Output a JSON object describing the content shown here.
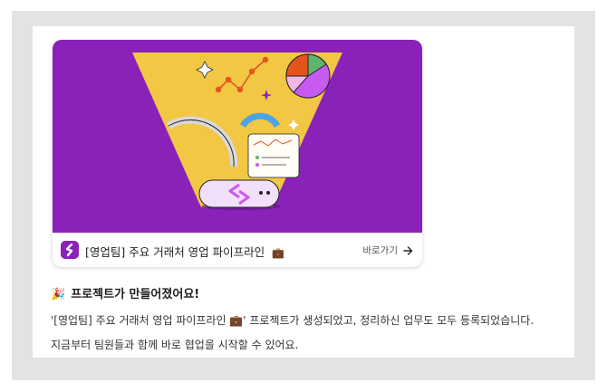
{
  "card": {
    "title": "[영업팀] 주요 거래처 영업 파이프라인",
    "title_emoji": "💼",
    "link_label": "바로가기",
    "link_icon": "arrow-right-icon",
    "banner_color": "#8a21b9",
    "accent_yellow": "#f1c744"
  },
  "message": {
    "title_emoji": "🎉",
    "title": "프로젝트가 만들어졌어요!",
    "line1": "'[영업팀] 주요 거래처 영업 파이프라인 💼' 프로젝트가 생성되었고, 정리하신 업무도 모두 등록되었습니다.",
    "line2": "지금부터 팀원들과 함께 바로 협업을 시작할 수 있어요."
  }
}
